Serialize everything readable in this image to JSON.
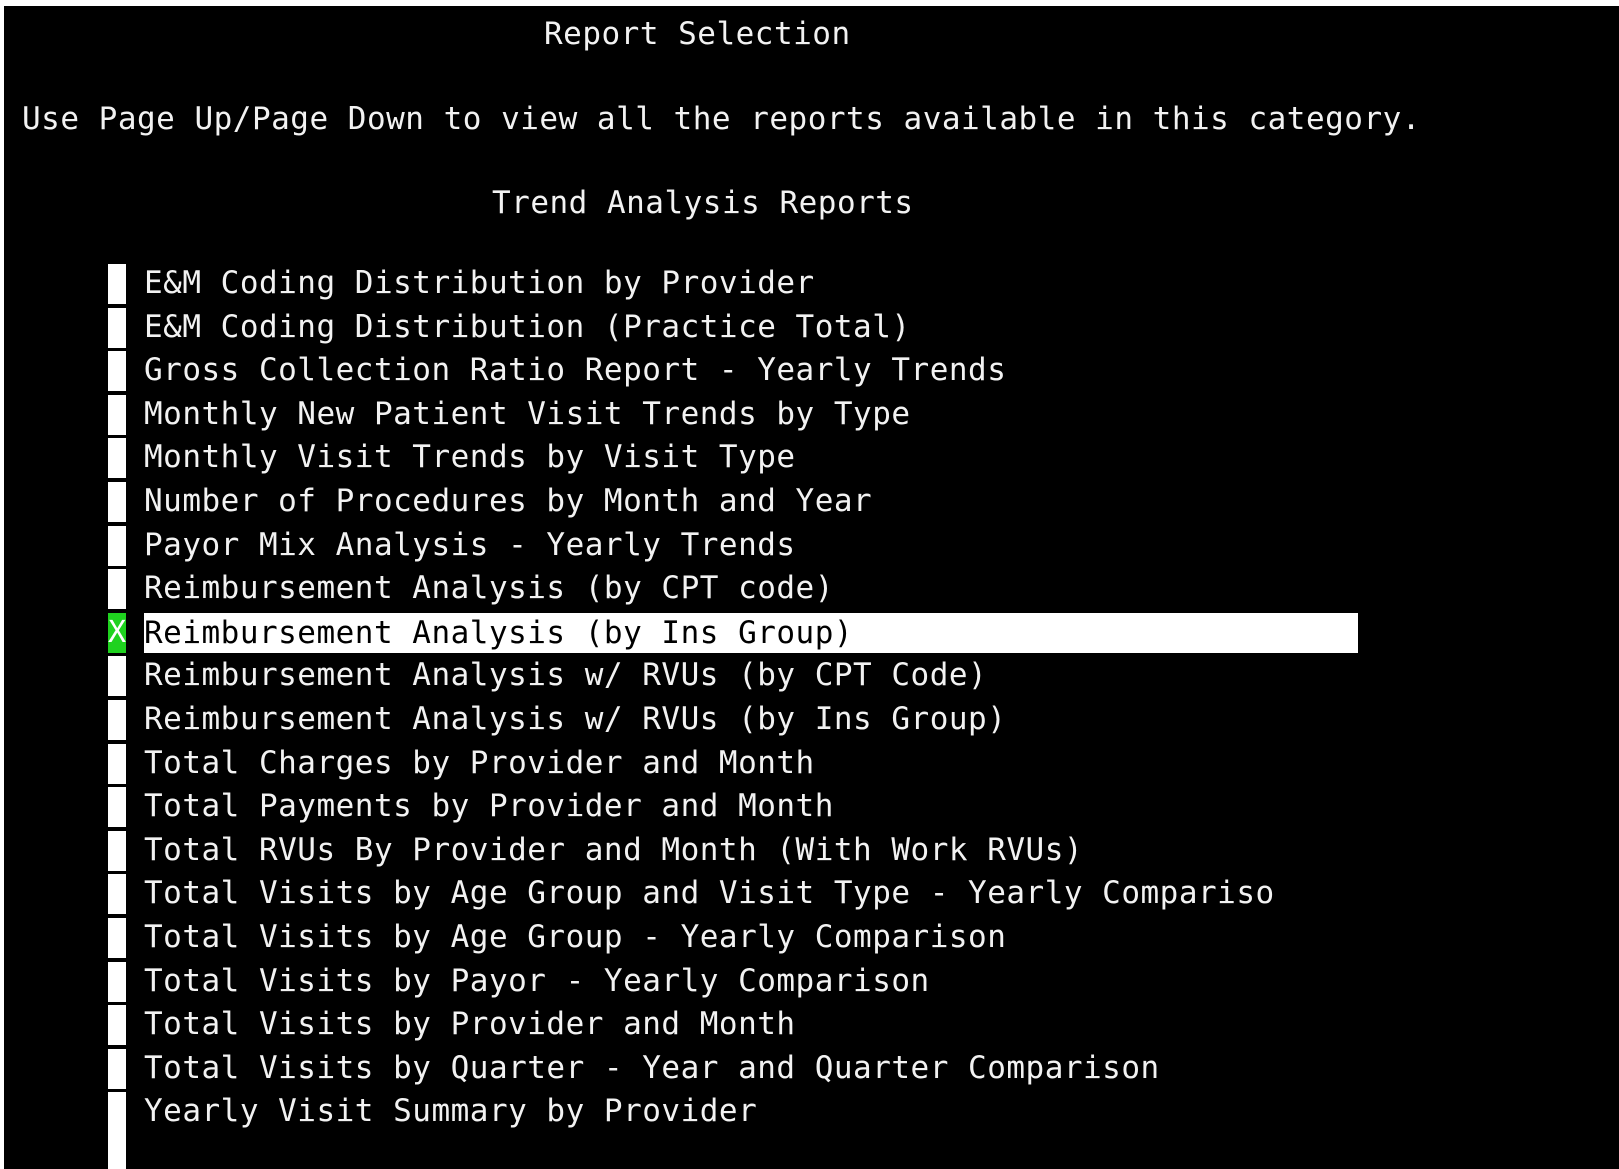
{
  "screen": {
    "title": "Report Selection",
    "instructions": "Use Page Up/Page Down to view all the reports available in this category.",
    "category": "Trend Analysis Reports"
  },
  "colors": {
    "background": "#000000",
    "text": "#f2f2f2",
    "selection_field": "#ffffff",
    "selected_marker": "#1fd21f",
    "highlight": "#ffffff"
  },
  "selected_index": 8,
  "reports": [
    {
      "label": "E&M Coding Distribution by Provider",
      "mark": ""
    },
    {
      "label": "E&M Coding Distribution (Practice Total)",
      "mark": ""
    },
    {
      "label": "Gross Collection Ratio Report - Yearly Trends",
      "mark": ""
    },
    {
      "label": "Monthly New Patient Visit Trends by Type",
      "mark": ""
    },
    {
      "label": "Monthly Visit Trends by Visit Type",
      "mark": ""
    },
    {
      "label": "Number of Procedures by Month and Year",
      "mark": ""
    },
    {
      "label": "Payor Mix Analysis - Yearly Trends",
      "mark": ""
    },
    {
      "label": "Reimbursement Analysis (by CPT code)",
      "mark": ""
    },
    {
      "label": "Reimbursement Analysis (by Ins Group)",
      "mark": "X"
    },
    {
      "label": "Reimbursement Analysis w/ RVUs (by CPT Code)",
      "mark": ""
    },
    {
      "label": "Reimbursement Analysis w/ RVUs (by Ins Group)",
      "mark": ""
    },
    {
      "label": "Total Charges by Provider and Month",
      "mark": ""
    },
    {
      "label": "Total Payments by Provider and Month",
      "mark": ""
    },
    {
      "label": "Total RVUs By Provider and Month (With Work RVUs)",
      "mark": ""
    },
    {
      "label": "Total Visits by Age Group and Visit Type - Yearly Compariso",
      "mark": ""
    },
    {
      "label": "Total Visits by Age Group - Yearly Comparison",
      "mark": ""
    },
    {
      "label": "Total Visits by Payor - Yearly Comparison",
      "mark": ""
    },
    {
      "label": "Total Visits by Provider and Month",
      "mark": ""
    },
    {
      "label": "Total Visits by Quarter - Year and Quarter Comparison",
      "mark": ""
    },
    {
      "label": "Yearly Visit Summary by Provider",
      "mark": ""
    }
  ]
}
